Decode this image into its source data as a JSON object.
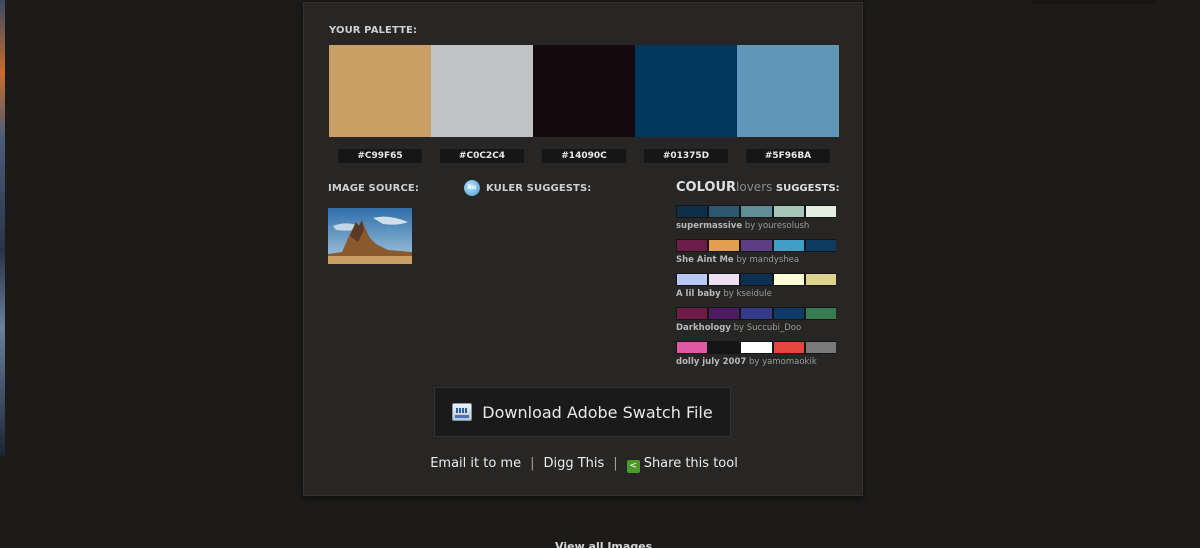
{
  "palette": {
    "label": "YOUR PALETTE:",
    "colors": [
      "#C99F65",
      "#C0C2C4",
      "#14090C",
      "#01375D",
      "#5F96BA"
    ],
    "hex_labels": [
      "#C99F65",
      "#C0C2C4",
      "#14090C",
      "#01375D",
      "#5F96BA"
    ]
  },
  "image_source": {
    "label": "IMAGE SOURCE:"
  },
  "kuler": {
    "label": "KULER SUGGESTS:",
    "icon_text": "ku"
  },
  "colourlovers": {
    "title_bold": "COLOUR",
    "title_light": "lovers",
    "title_suffix": " SUGGESTS:",
    "palettes": [
      {
        "name": "supermassive",
        "by": "by youresolush",
        "colors": [
          "#0e2f4a",
          "#2b5870",
          "#5e8f98",
          "#a6c5b9",
          "#e2f0df"
        ]
      },
      {
        "name": "She Aint Me",
        "by": "by mandyshea",
        "colors": [
          "#6a1e48",
          "#e2a04e",
          "#5c3e82",
          "#3f9fc6",
          "#0c3c62"
        ]
      },
      {
        "name": "A lil baby",
        "by": "by kseidule",
        "colors": [
          "#b8c8f4",
          "#ece0f2",
          "#0c2f52",
          "#fffcd8",
          "#ddd38c"
        ]
      },
      {
        "name": "Darkhology",
        "by": "by Succubi_Doo",
        "colors": [
          "#6d1c46",
          "#4a1d61",
          "#353a86",
          "#103a62",
          "#3a7a50"
        ]
      },
      {
        "name": "dolly july 2007",
        "by": "by yamomaokik",
        "colors": [
          "#e05aa3",
          "#141414",
          "#ffffff",
          "#e2463c",
          "#7a7a7a"
        ]
      }
    ]
  },
  "download": {
    "label": "Download Adobe Swatch File"
  },
  "links": {
    "email": "Email it to me",
    "digg": "Digg This",
    "share": "Share this tool",
    "separator": "|"
  },
  "footer": {
    "text": "View all Images"
  }
}
